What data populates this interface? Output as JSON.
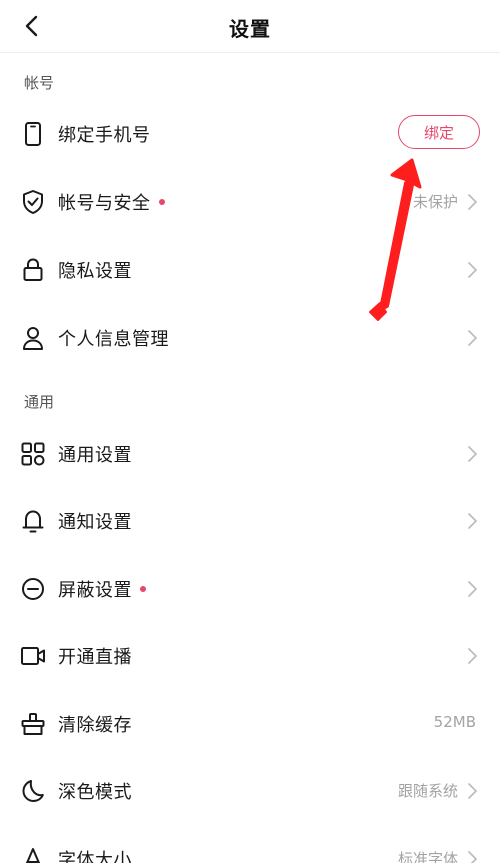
{
  "header": {
    "title": "设置"
  },
  "sections": {
    "account": {
      "title": "帐号"
    },
    "general": {
      "title": "通用"
    }
  },
  "rows": {
    "bind_phone": {
      "label": "绑定手机号",
      "button": "绑定"
    },
    "account_security": {
      "label": "帐号与安全",
      "value": "未保护",
      "has_dot": true
    },
    "privacy": {
      "label": "隐私设置"
    },
    "personal_info": {
      "label": "个人信息管理"
    },
    "general_settings": {
      "label": "通用设置"
    },
    "notification": {
      "label": "通知设置"
    },
    "block": {
      "label": "屏蔽设置",
      "has_dot": true
    },
    "live": {
      "label": "开通直播"
    },
    "clear_cache": {
      "label": "清除缓存",
      "value": "52MB"
    },
    "dark_mode": {
      "label": "深色模式",
      "value": "跟随系统"
    },
    "font_size": {
      "label": "字体大小",
      "value": "标准字体"
    }
  },
  "icons": {
    "back": "chevron-left-icon",
    "phone": "phone-icon",
    "shield": "shield-check-icon",
    "lock": "lock-icon",
    "person": "person-icon",
    "grid": "grid-icon",
    "bell": "bell-icon",
    "block": "block-icon",
    "video": "video-camera-icon",
    "broom": "clean-icon",
    "moon": "moon-icon",
    "font": "font-icon"
  },
  "colors": {
    "accent": "#e6486b",
    "annotation_arrow": "#ff1e1e",
    "secondary_text": "#a3a3a3",
    "section_text": "#555555"
  }
}
